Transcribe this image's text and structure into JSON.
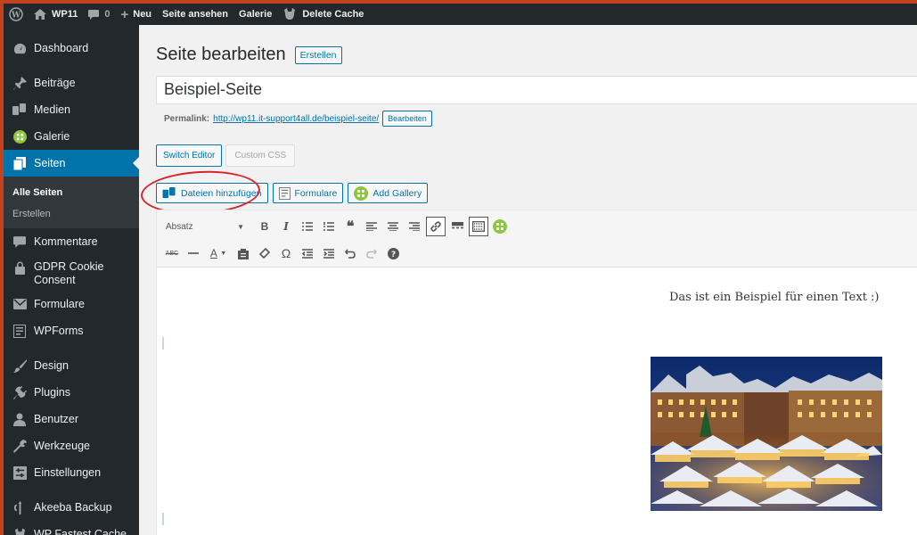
{
  "adminbar": {
    "site_name": "WP11",
    "comments_count": "0",
    "new_label": "Neu",
    "view_label": "Seite ansehen",
    "gallery_label": "Galerie",
    "cache_label": "Delete Cache"
  },
  "sidebar": {
    "items": [
      {
        "label": "Dashboard",
        "icon": "dashboard-icon"
      },
      {
        "label": "Beiträge",
        "icon": "pin-icon"
      },
      {
        "label": "Medien",
        "icon": "media-icon"
      },
      {
        "label": "Galerie",
        "icon": "gallery-icon"
      },
      {
        "label": "Seiten",
        "icon": "pages-icon",
        "active": true
      },
      {
        "label": "Kommentare",
        "icon": "comment-icon"
      },
      {
        "label": "GDPR Cookie Consent",
        "icon": "lock-icon"
      },
      {
        "label": "Formulare",
        "icon": "mail-icon"
      },
      {
        "label": "WPForms",
        "icon": "form-icon"
      },
      {
        "label": "Design",
        "icon": "brush-icon"
      },
      {
        "label": "Plugins",
        "icon": "plug-icon"
      },
      {
        "label": "Benutzer",
        "icon": "user-icon"
      },
      {
        "label": "Werkzeuge",
        "icon": "wrench-icon"
      },
      {
        "label": "Einstellungen",
        "icon": "settings-icon"
      },
      {
        "label": "Akeeba Backup",
        "icon": "backup-icon"
      },
      {
        "label": "WP Fastest Cache",
        "icon": "cache-icon"
      }
    ],
    "submenu": {
      "current": "Alle Seiten",
      "other": "Erstellen"
    }
  },
  "page": {
    "heading": "Seite bearbeiten",
    "create_button": "Erstellen",
    "title_value": "Beispiel-Seite",
    "permalink_label": "Permalink:",
    "permalink_url": "http://wp11.it-support4all.de/beispiel-seite/",
    "permalink_edit": "Bearbeiten",
    "switch_editor": "Switch Editor",
    "custom_css": "Custom CSS"
  },
  "media_buttons": {
    "add_media": "Dateien hinzufügen",
    "forms": "Formulare",
    "gallery": "Add Gallery"
  },
  "toolbar": {
    "format_select": "Absatz"
  },
  "content": {
    "paragraph": "Das ist ein Beispiel für einen Text :)"
  },
  "colors": {
    "accent": "#0073aa",
    "sidebar_bg": "#23282d",
    "frame": "#c1431f",
    "annotation": "#d7262b"
  }
}
